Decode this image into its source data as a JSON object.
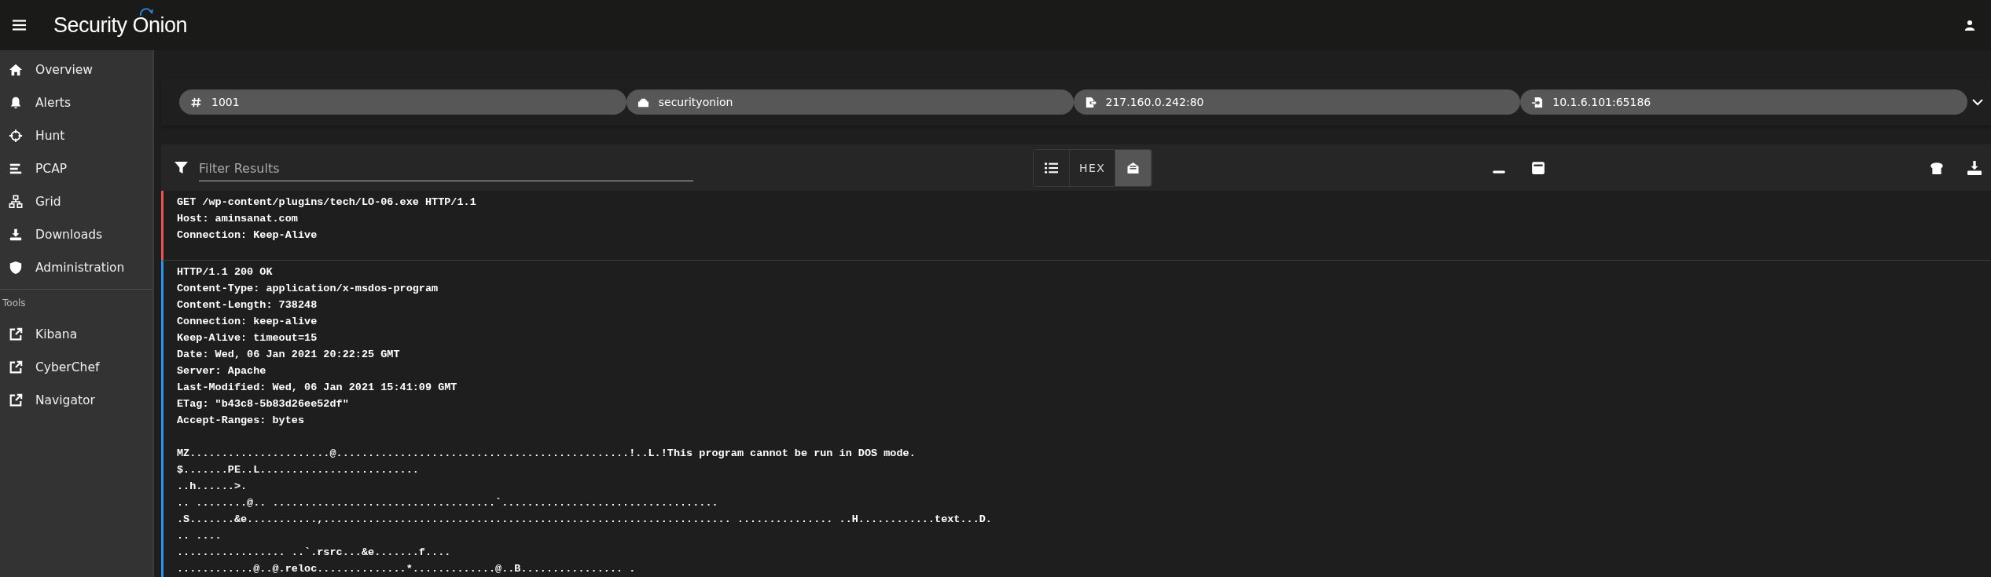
{
  "header": {
    "title": "Security Onion"
  },
  "sidebar": {
    "items": [
      {
        "label": "Overview",
        "kind": "home",
        "selected": false
      },
      {
        "label": "Alerts",
        "kind": "alerts",
        "selected": false
      },
      {
        "label": "Hunt",
        "kind": "hunt",
        "selected": false
      },
      {
        "label": "PCAP",
        "kind": "pcap",
        "selected": false
      },
      {
        "label": "Grid",
        "kind": "grid",
        "selected": false
      },
      {
        "label": "Downloads",
        "kind": "downloads",
        "selected": false
      },
      {
        "label": "Administration",
        "kind": "admin",
        "selected": false
      }
    ],
    "tools_heading": "Tools",
    "tools": [
      {
        "label": "Kibana"
      },
      {
        "label": "CyberChef"
      },
      {
        "label": "Navigator"
      }
    ]
  },
  "chips": [
    {
      "kind": "id",
      "text": "1001"
    },
    {
      "kind": "sensor",
      "text": "securityonion"
    },
    {
      "kind": "source",
      "text": "217.160.0.242:80"
    },
    {
      "kind": "destination",
      "text": "10.1.6.101:65186"
    }
  ],
  "toolbar": {
    "filter_placeholder": "Filter Results",
    "views": [
      {
        "kind": "list",
        "selected": false
      },
      {
        "kind": "hex",
        "label": "HEX",
        "selected": false
      },
      {
        "kind": "transcript",
        "selected": true
      }
    ]
  },
  "streams": [
    {
      "kind": "request",
      "header_lines": [
        "GET /wp-content/plugins/tech/LO-06.exe HTTP/1.1",
        "Host: aminsanat.com",
        "Connection: Keep-Alive"
      ]
    },
    {
      "kind": "response",
      "header_lines": [
        "HTTP/1.1 200 OK",
        "Content-Type: application/x-msdos-program",
        "Content-Length: 738248",
        "Connection: keep-alive",
        "Keep-Alive: timeout=15",
        "Date: Wed, 06 Jan 2021 20:22:25 GMT",
        "Server: Apache",
        "Last-Modified: Wed, 06 Jan 2021 15:41:09 GMT",
        "ETag: \"b43c8-5b83d26ee52df\"",
        "Accept-Ranges: bytes"
      ],
      "payload_lines": [
        "MZ......................@..............................................!..L.!This program cannot be run in DOS mode.",
        "$.......PE..L.........................",
        "..h......>.",
        ".. ........@.. ...................................`..................................",
        ".S.......&e...........,................................................................ ............... ..H............text...D.",
        ".. ....",
        "................. ..`.rsrc...&e.......f....",
        "............@..@.reloc..............*.............@..B................ ."
      ]
    }
  ]
}
